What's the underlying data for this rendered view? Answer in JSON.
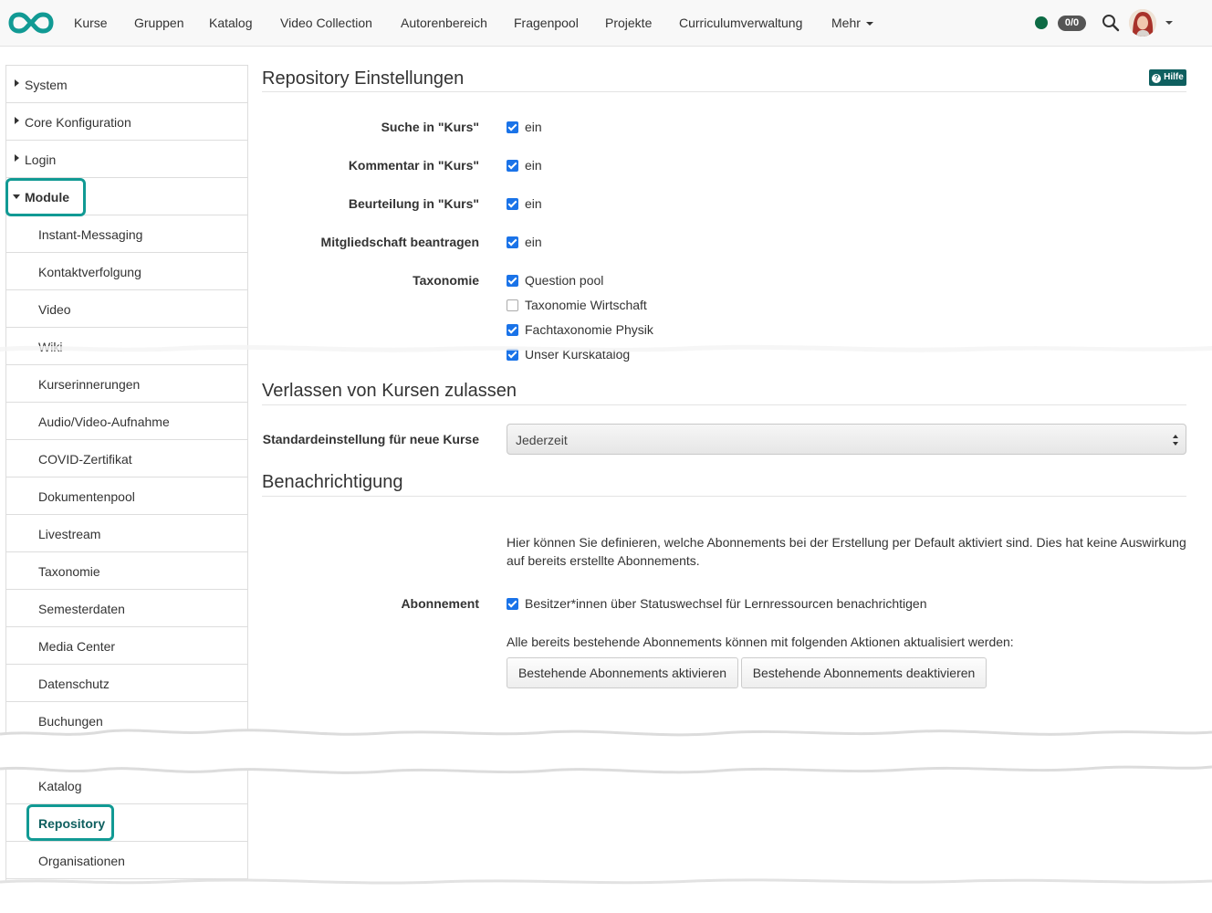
{
  "nav": {
    "items": [
      "Kurse",
      "Gruppen",
      "Katalog",
      "Video Collection",
      "Autorenbereich",
      "Fragenpool",
      "Projekte",
      "Curriculumverwaltung"
    ],
    "more_label": "Mehr",
    "badge": "0/0",
    "colors": {
      "logo": "#119a94",
      "status_dot": "#0d6b45"
    }
  },
  "sidebar": {
    "top_items": [
      "System",
      "Core Konfiguration",
      "Login"
    ],
    "module_label": "Module",
    "module_items": [
      "Instant-Messaging",
      "Kontaktverfolgung",
      "Video",
      "Wiki",
      "Kurserinnerungen",
      "Audio/Video-Aufnahme",
      "COVID-Zertifikat",
      "Dokumentenpool",
      "Livestream",
      "Taxonomie",
      "Semesterdaten",
      "Media Center",
      "Datenschutz",
      "Buchungen"
    ],
    "lower_items": [
      "Katalog",
      "Repository",
      "Organisationen"
    ],
    "active_item": "Repository",
    "highlight_color": "#119a94"
  },
  "main": {
    "title": "Repository Einstellungen",
    "help_label": "Hilfe",
    "settings": [
      {
        "label": "Suche in \"Kurs\"",
        "value": "ein",
        "checked": true
      },
      {
        "label": "Kommentar in \"Kurs\"",
        "value": "ein",
        "checked": true
      },
      {
        "label": "Beurteilung in \"Kurs\"",
        "value": "ein",
        "checked": true
      },
      {
        "label": "Mitgliedschaft beantragen",
        "value": "ein",
        "checked": true
      }
    ],
    "taxonomy_label": "Taxonomie",
    "taxonomy_options": [
      {
        "label": "Question pool",
        "checked": true
      },
      {
        "label": "Taxonomie Wirtschaft",
        "checked": false
      },
      {
        "label": "Fachtaxonomie Physik",
        "checked": true
      },
      {
        "label": "Unser Kurskatalog",
        "checked": true
      }
    ],
    "leave": {
      "title": "Verlassen von Kursen zulassen",
      "field_label": "Standardeinstellung für neue Kurse",
      "selected": "Jederzeit"
    },
    "notify": {
      "title": "Benachrichtigung",
      "description": "Hier können Sie definieren, welche Abonnements bei der Erstellung per Default aktiviert sind. Dies hat keine Auswirkung auf bereits erstellte Abonnements.",
      "subscription_label": "Abonnement",
      "subscription_option": "Besitzer*innen über Statuswechsel für Lernressourcen benachrichtigen",
      "subscription_checked": true,
      "actions_text": "Alle bereits bestehende Abonnements können mit folgenden Aktionen aktualisiert werden:",
      "activate_button": "Bestehende Abonnements aktivieren",
      "deactivate_button": "Bestehende Abonnements deaktivieren"
    }
  }
}
